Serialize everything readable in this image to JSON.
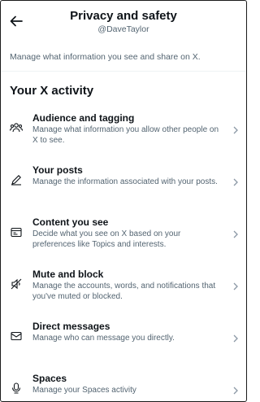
{
  "header": {
    "title": "Privacy and safety",
    "handle": "@DaveTaylor",
    "back_icon": "arrow-left-icon"
  },
  "intro": "Manage what information you see and share on X.",
  "section": {
    "title": "Your X activity"
  },
  "items": [
    {
      "label": "Audience and tagging",
      "description": "Manage what information you allow other people on X to see.",
      "icon": "people-icon"
    },
    {
      "label": "Your posts",
      "description": "Manage the information associated with your posts.",
      "icon": "pencil-icon"
    },
    {
      "label": "Content you see",
      "description": "Decide what you see on X based on your preferences like Topics and interests.",
      "icon": "content-icon"
    },
    {
      "label": "Mute and block",
      "description": "Manage the accounts, words, and notifications that you've muted or blocked.",
      "icon": "mute-icon"
    },
    {
      "label": "Direct messages",
      "description": "Manage who can message you directly.",
      "icon": "envelope-icon"
    },
    {
      "label": "Spaces",
      "description": "Manage your Spaces activity",
      "icon": "microphone-icon"
    }
  ],
  "colors": {
    "text": "#0f1419",
    "secondary": "#536471",
    "divider": "#eff3f4"
  }
}
